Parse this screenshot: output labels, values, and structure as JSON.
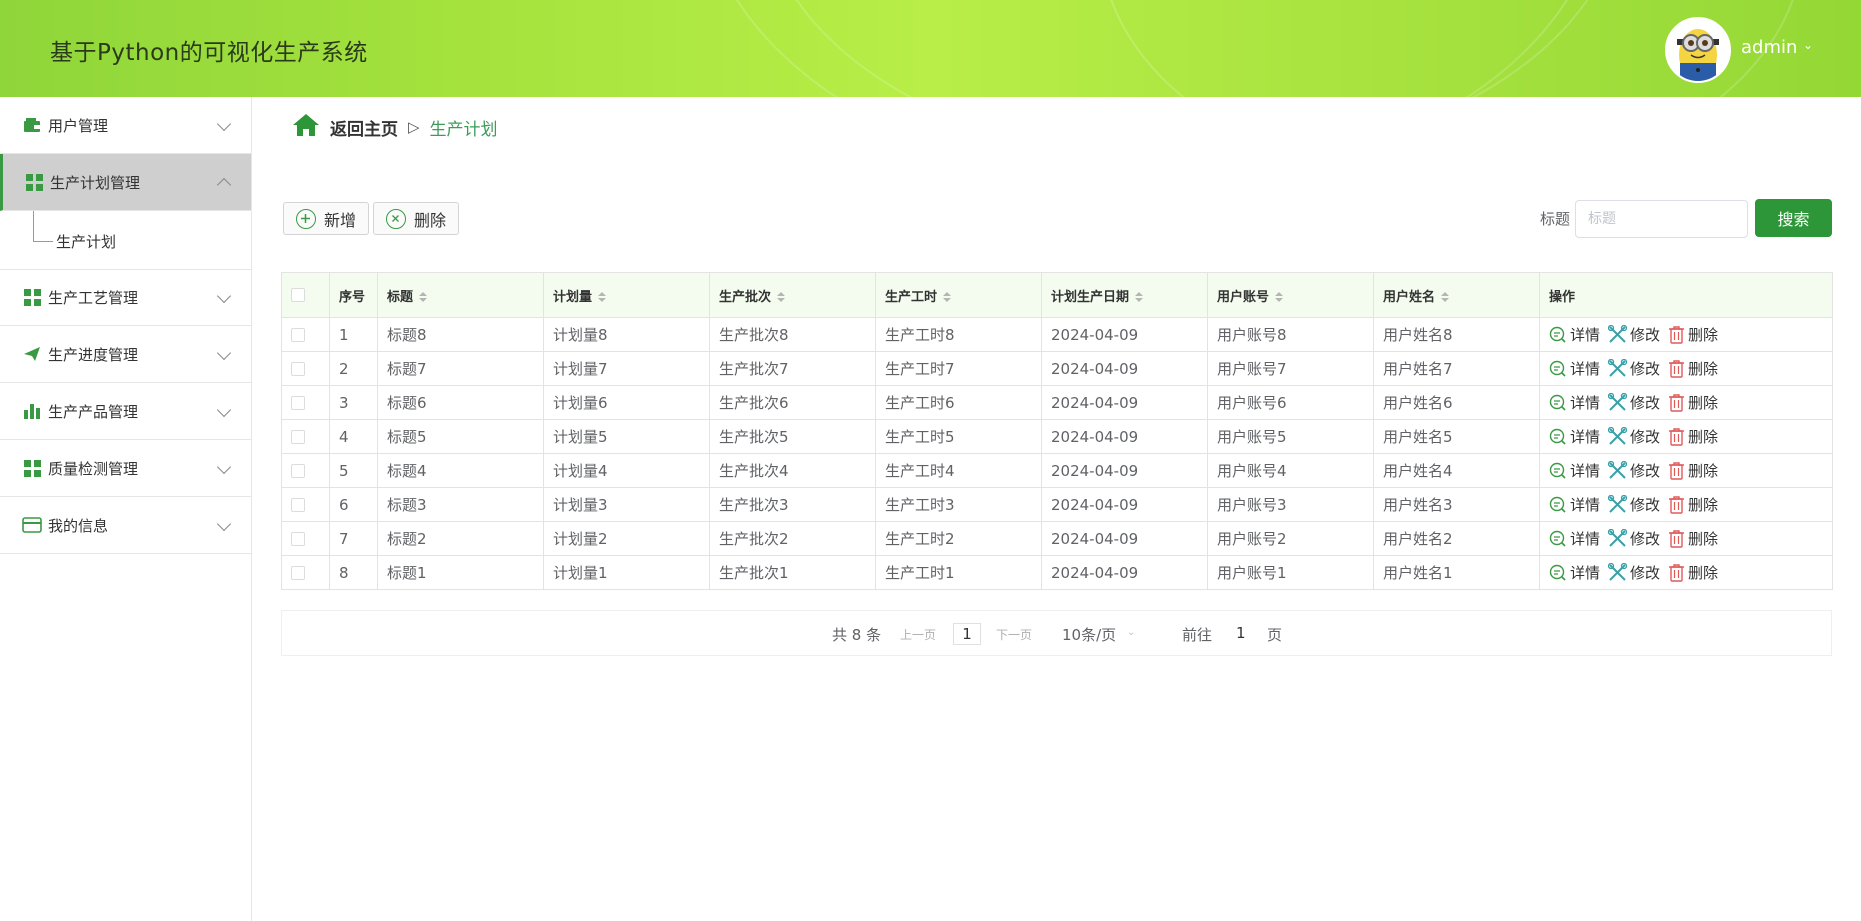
{
  "header": {
    "app_title": "基于Python的可视化生产系统",
    "user": "admin",
    "colors": {
      "header_bg": "#a6e23e",
      "accent": "#2c9638"
    }
  },
  "sidebar": {
    "items": [
      {
        "label": "用户管理",
        "icon": "wallet-icon"
      },
      {
        "label": "生产计划管理",
        "icon": "grid-icon",
        "active": true
      },
      {
        "label": "生产工艺管理",
        "icon": "grid-icon"
      },
      {
        "label": "生产进度管理",
        "icon": "paper-plane-icon"
      },
      {
        "label": "生产产品管理",
        "icon": "bar-chart-icon"
      },
      {
        "label": "质量检测管理",
        "icon": "grid-icon"
      },
      {
        "label": "我的信息",
        "icon": "card-icon"
      }
    ],
    "submenu": {
      "label": "生产计划"
    }
  },
  "breadcrumb": {
    "home": "返回主页",
    "separator": "▷",
    "current": "生产计划"
  },
  "toolbar": {
    "add_label": "新增",
    "delete_label": "删除"
  },
  "search": {
    "label": "标题",
    "placeholder": "标题",
    "value": "",
    "button": "搜索"
  },
  "table": {
    "columns": [
      "序号",
      "标题",
      "计划量",
      "生产批次",
      "生产工时",
      "计划生产日期",
      "用户账号",
      "用户姓名",
      "操作"
    ],
    "actions": {
      "detail": "详情",
      "edit": "修改",
      "delete": "删除"
    },
    "rows": [
      {
        "no": "1",
        "title": "标题8",
        "plan": "计划量8",
        "batch": "生产批次8",
        "hours": "生产工时8",
        "date": "2024-04-09",
        "account": "用户账号8",
        "name": "用户姓名8"
      },
      {
        "no": "2",
        "title": "标题7",
        "plan": "计划量7",
        "batch": "生产批次7",
        "hours": "生产工时7",
        "date": "2024-04-09",
        "account": "用户账号7",
        "name": "用户姓名7"
      },
      {
        "no": "3",
        "title": "标题6",
        "plan": "计划量6",
        "batch": "生产批次6",
        "hours": "生产工时6",
        "date": "2024-04-09",
        "account": "用户账号6",
        "name": "用户姓名6"
      },
      {
        "no": "4",
        "title": "标题5",
        "plan": "计划量5",
        "batch": "生产批次5",
        "hours": "生产工时5",
        "date": "2024-04-09",
        "account": "用户账号5",
        "name": "用户姓名5"
      },
      {
        "no": "5",
        "title": "标题4",
        "plan": "计划量4",
        "batch": "生产批次4",
        "hours": "生产工时4",
        "date": "2024-04-09",
        "account": "用户账号4",
        "name": "用户姓名4"
      },
      {
        "no": "6",
        "title": "标题3",
        "plan": "计划量3",
        "batch": "生产批次3",
        "hours": "生产工时3",
        "date": "2024-04-09",
        "account": "用户账号3",
        "name": "用户姓名3"
      },
      {
        "no": "7",
        "title": "标题2",
        "plan": "计划量2",
        "batch": "生产批次2",
        "hours": "生产工时2",
        "date": "2024-04-09",
        "account": "用户账号2",
        "name": "用户姓名2"
      },
      {
        "no": "8",
        "title": "标题1",
        "plan": "计划量1",
        "batch": "生产批次1",
        "hours": "生产工时1",
        "date": "2024-04-09",
        "account": "用户账号1",
        "name": "用户姓名1"
      }
    ]
  },
  "pagination": {
    "total": "共 8 条",
    "prev": "上一页",
    "page": "1",
    "next": "下一页",
    "page_size": "10条/页",
    "goto_prefix": "前往",
    "goto_value": "1",
    "goto_suffix": "页"
  }
}
